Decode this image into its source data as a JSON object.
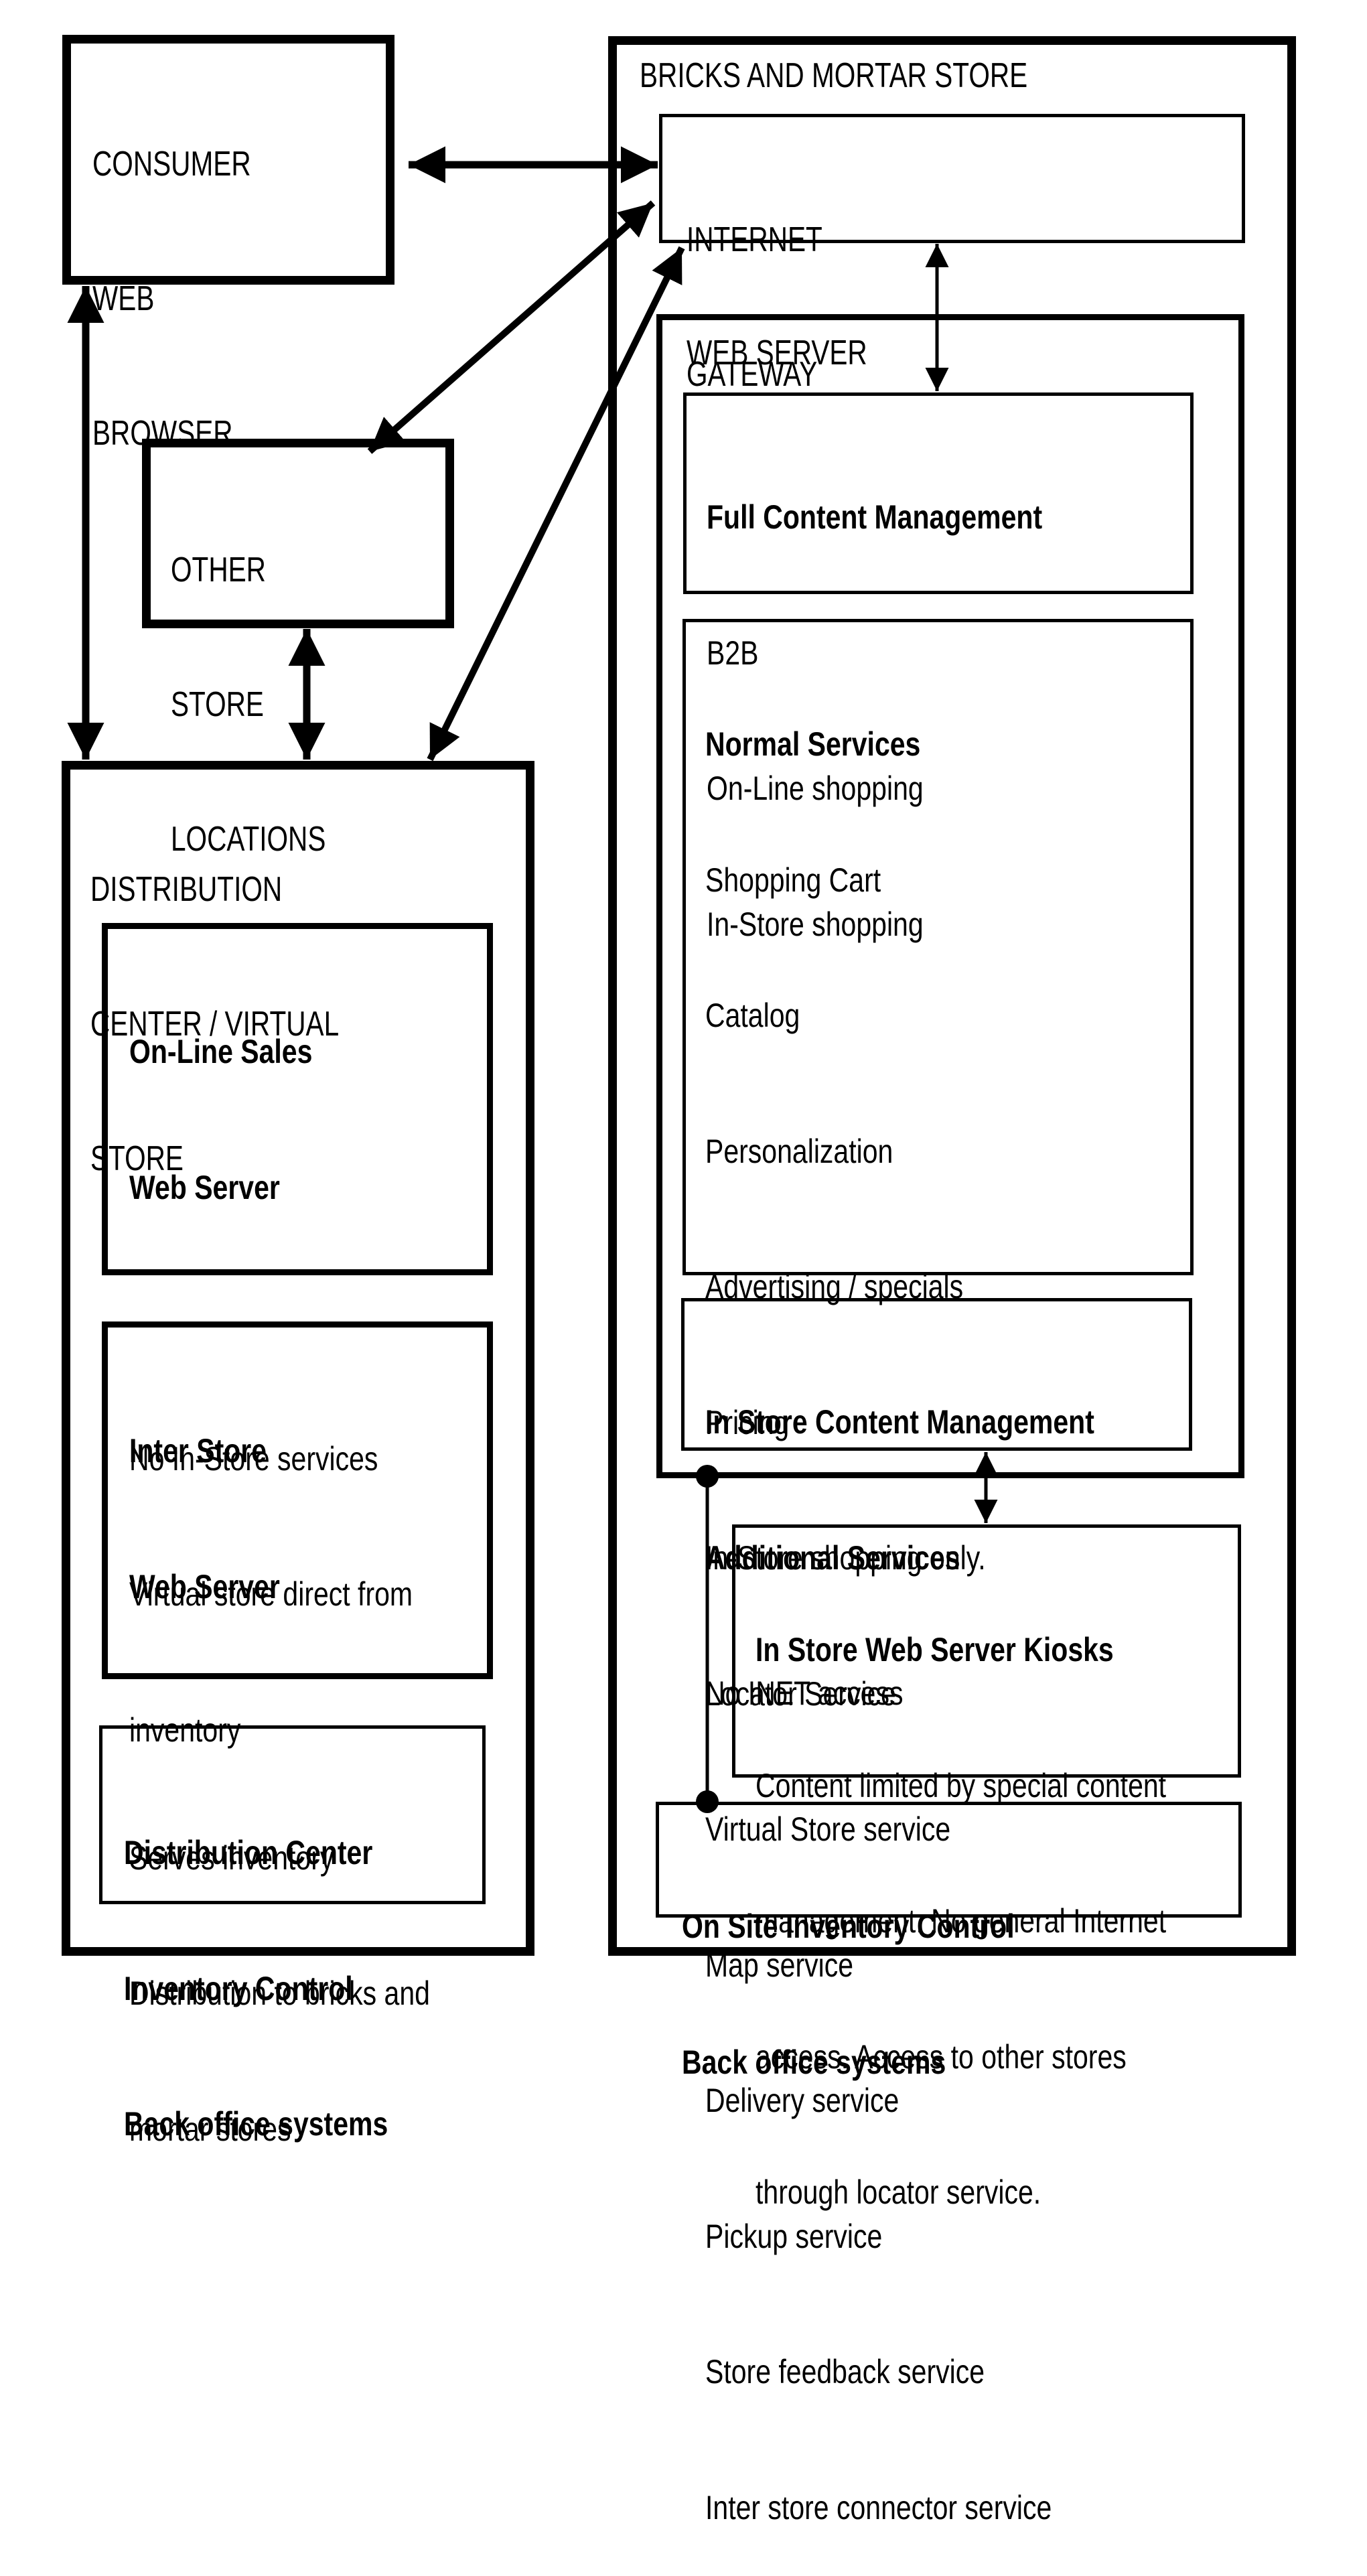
{
  "diagram": {
    "consumer_browser": {
      "lines": [
        "CONSUMER",
        "WEB",
        "BROWSER"
      ]
    },
    "other_store_locations": {
      "lines": [
        "OTHER",
        "STORE",
        "LOCATIONS"
      ]
    },
    "distribution_center": {
      "title_lines": [
        "DISTRIBUTION",
        "CENTER / VIRTUAL",
        "STORE"
      ],
      "online_sales": {
        "title_lines": [
          "On-Line Sales",
          "Web Server"
        ],
        "items": [
          "No In-Store services",
          "Virtual store direct from",
          "inventory"
        ]
      },
      "inter_store": {
        "title_lines": [
          "Inter Store",
          "Web Server"
        ],
        "items": [
          "Serves inventory",
          "Distribution to bricks and",
          "mortar stores"
        ]
      },
      "dc_inventory": {
        "lines": [
          "Distribution Center",
          "Inventory Control",
          "Back office systems"
        ]
      }
    },
    "bricks_and_mortar": {
      "title": "BRICKS AND MORTAR STORE",
      "internet_gateway": {
        "lines": [
          "INTERNET",
          "GATEWAY"
        ]
      },
      "web_server": {
        "title": "WEB SERVER",
        "full_content": {
          "title": "Full Content Management",
          "items": [
            "B2B",
            "On-Line shopping",
            "In-Store shopping"
          ]
        },
        "services": {
          "normal_title": "Normal Services",
          "normal_items": [
            "Shopping Cart",
            "Catalog",
            "Personalization",
            "Advertising / specials",
            "Pricing"
          ],
          "additional_title": "Additional Services",
          "additional_items": [
            "Locator Service",
            "Virtual Store service",
            "Map service",
            "Delivery service",
            "Pickup service",
            "Store feedback service",
            "Inter store connector service"
          ]
        },
        "in_store_content": {
          "title": "In Store Content Management",
          "items": [
            "In-Store shopping only.",
            "No INET access"
          ]
        }
      },
      "kiosks": {
        "title": "In Store Web Server Kiosks",
        "items": [
          "Content limited by special content",
          "management. No general Internet",
          "access. Access to other stores",
          "through locator service."
        ]
      },
      "onsite_inventory": {
        "lines": [
          "On Site Inventory Control",
          "Back office systems"
        ]
      }
    },
    "connections": [
      {
        "from": "consumer_browser",
        "to": "internet_gateway",
        "type": "bidirectional"
      },
      {
        "from": "internet_gateway",
        "to": "other_store_locations",
        "type": "bidirectional"
      },
      {
        "from": "internet_gateway",
        "to": "distribution_center",
        "type": "bidirectional"
      },
      {
        "from": "consumer_browser",
        "to": "distribution_center",
        "type": "bidirectional"
      },
      {
        "from": "other_store_locations",
        "to": "distribution_center",
        "type": "bidirectional"
      },
      {
        "from": "internet_gateway",
        "to": "web_server",
        "type": "bidirectional"
      },
      {
        "from": "in_store_content",
        "to": "kiosks",
        "type": "bidirectional"
      },
      {
        "from": "web_server",
        "to": "onsite_inventory",
        "type": "link-dots"
      }
    ]
  }
}
